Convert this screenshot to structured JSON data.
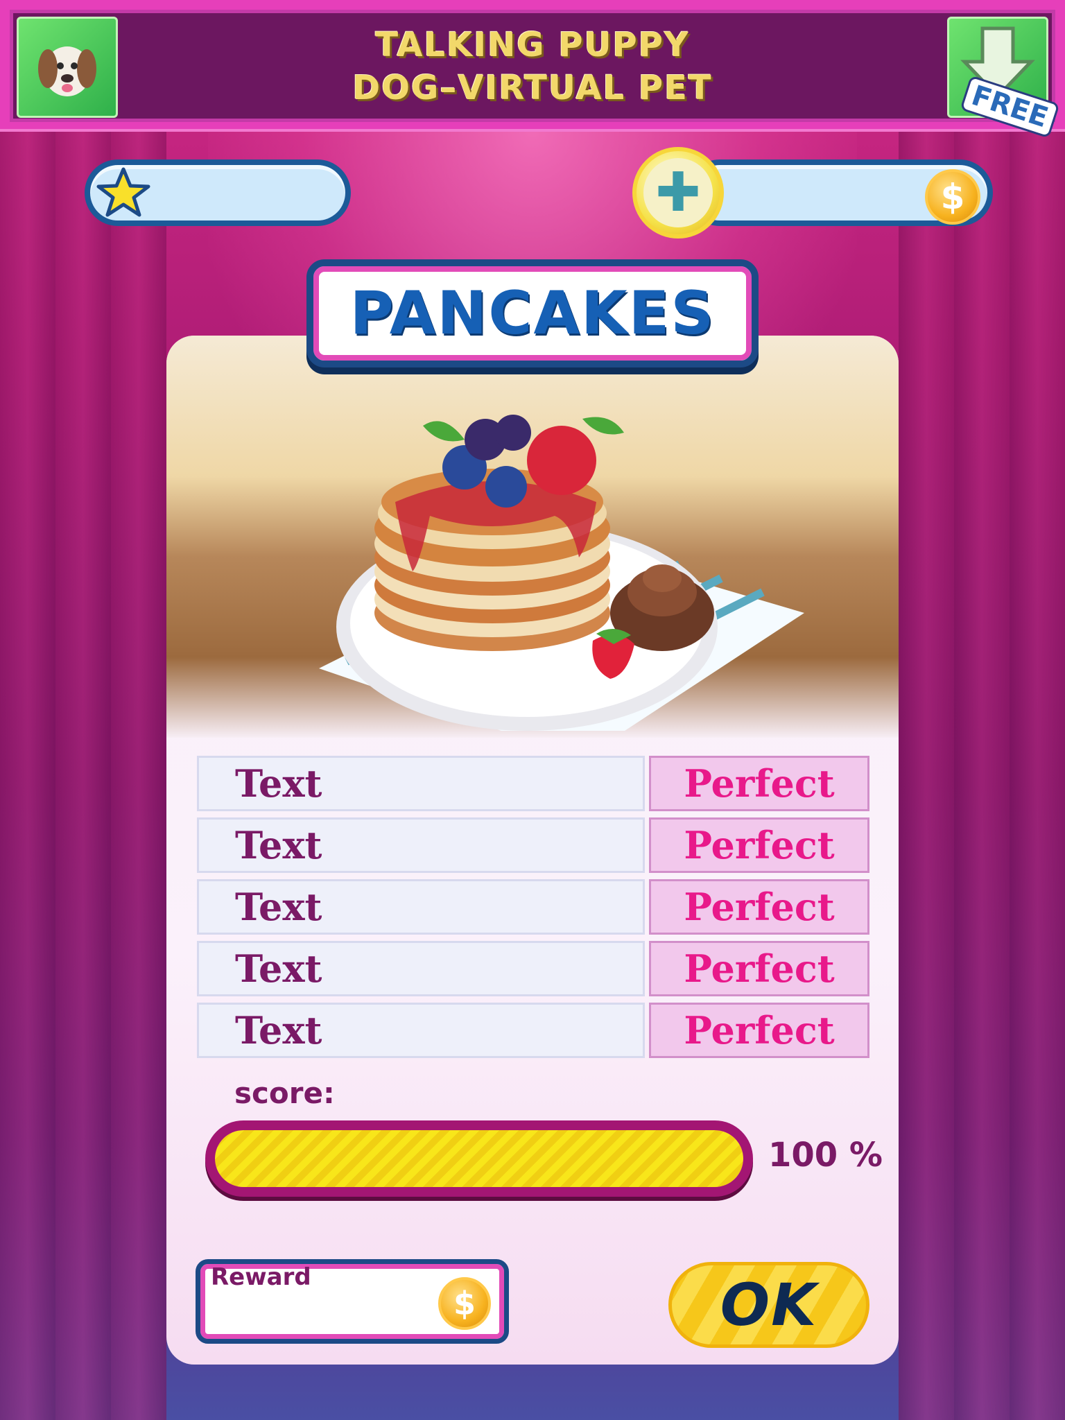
{
  "banner": {
    "title_line1": "TALKING PUPPY",
    "title_line2": "DOG–VIRTUAL PET",
    "free_label": "FREE"
  },
  "stats": {
    "stars_value": "",
    "coins_value": "",
    "plus_symbol": "✚",
    "coin_symbol": "$"
  },
  "title": "PANCAKES",
  "rows": [
    {
      "label": "Text",
      "value": "Perfect"
    },
    {
      "label": "Text",
      "value": "Perfect"
    },
    {
      "label": "Text",
      "value": "Perfect"
    },
    {
      "label": "Text",
      "value": "Perfect"
    },
    {
      "label": "Text",
      "value": "Perfect"
    }
  ],
  "score": {
    "label": "score:",
    "percent_text": "100 %",
    "fraction": 1.0
  },
  "reward": {
    "label": "Reward",
    "value": ""
  },
  "ok_label": "OK",
  "colors": {
    "accent_pink": "#e8198a",
    "dark_purple": "#7a1a66",
    "navy": "#1c4a86",
    "gold": "#f6c71a"
  }
}
